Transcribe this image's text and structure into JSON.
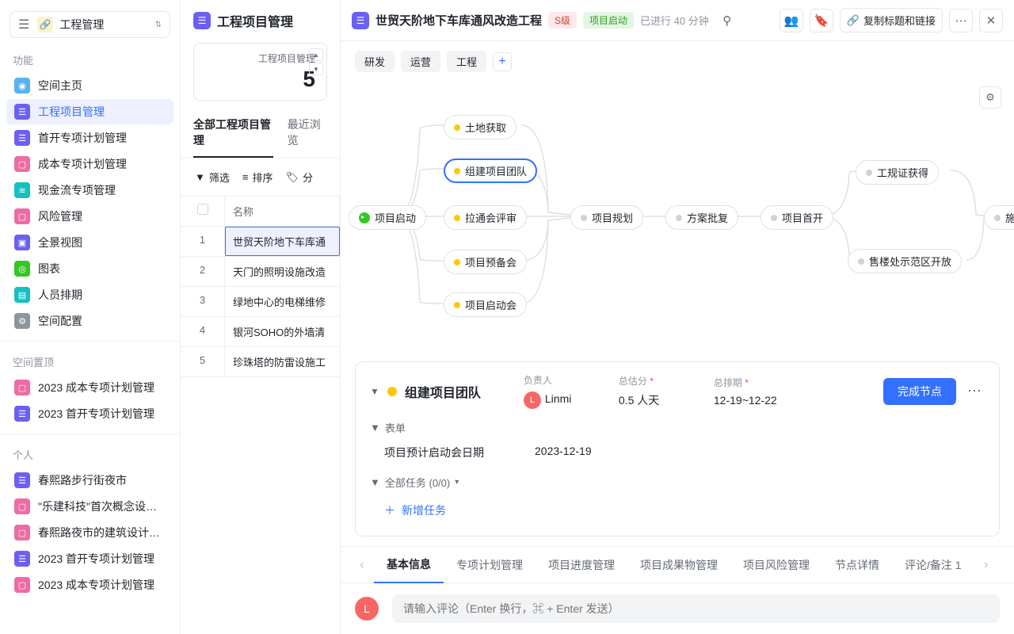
{
  "workspace": {
    "name": "工程管理"
  },
  "sidebar": {
    "sec_func": "功能",
    "func": [
      {
        "label": "空间主页",
        "color": "#5bb1f2",
        "icon": "◉"
      },
      {
        "label": "工程项目管理",
        "color": "#6b5ff5",
        "icon": "☰",
        "active": true
      },
      {
        "label": "首开专项计划管理",
        "color": "#6b5ff5",
        "icon": "☰"
      },
      {
        "label": "成本专项计划管理",
        "color": "#ee6ba5",
        "icon": "▢"
      },
      {
        "label": "现金流专项管理",
        "color": "#14c0c0",
        "icon": "≋"
      },
      {
        "label": "风险管理",
        "color": "#ee6ba5",
        "icon": "▢"
      },
      {
        "label": "全景视图",
        "color": "#6b5ff5",
        "icon": "▣"
      },
      {
        "label": "图表",
        "color": "#34c724",
        "icon": "◎"
      },
      {
        "label": "人员排期",
        "color": "#14c0c0",
        "icon": "▤"
      },
      {
        "label": "空间配置",
        "color": "#8f959e",
        "icon": "⚙"
      }
    ],
    "sec_pin": "空间置顶",
    "pin": [
      {
        "label": "2023 成本专项计划管理",
        "color": "#ee6ba5",
        "icon": "▢"
      },
      {
        "label": "2023 首开专项计划管理",
        "color": "#6b5ff5",
        "icon": "☰"
      }
    ],
    "sec_personal": "个人",
    "personal": [
      {
        "label": "春熙路步行街夜市",
        "color": "#6b5ff5",
        "icon": "☰"
      },
      {
        "label": "\"乐建科技\"首次概念设计计...",
        "color": "#ee6ba5",
        "icon": "▢"
      },
      {
        "label": "春熙路夜市的建筑设计风险",
        "color": "#ee6ba5",
        "icon": "▢"
      },
      {
        "label": "2023 首开专项计划管理",
        "color": "#6b5ff5",
        "icon": "☰"
      },
      {
        "label": "2023 成本专项计划管理",
        "color": "#ee6ba5",
        "icon": "▢"
      }
    ]
  },
  "mid": {
    "title": "工程项目管理",
    "stat_lbl": "工程项目管理",
    "stat_val": "5",
    "tabs": [
      "全部工程项目管理",
      "最近浏览"
    ],
    "tool_filter": "筛选",
    "tool_sort": "排序",
    "tool_group": "分",
    "col_name": "名称",
    "rows": [
      "世贸天阶地下车库通",
      "天门的照明设施改造",
      "绿地中心的电梯维修",
      "银河SOHO的外墙清",
      "珍珠塔的防雷设施工"
    ]
  },
  "top": {
    "title": "世贸天阶地下车库通风改造工程",
    "level": "S级",
    "phase": "项目启动",
    "status": "已进行 40 分钟",
    "copy": "复制标题和链接"
  },
  "tags": [
    "研发",
    "运营",
    "工程"
  ],
  "flow": {
    "n1": "项目启动",
    "n2a": "土地获取",
    "n2b": "组建项目团队",
    "n2c": "拉通会评审",
    "n2d": "项目预备会",
    "n2e": "项目启动会",
    "n3": "项目规划",
    "n4": "方案批复",
    "n5": "项目首开",
    "n6a": "工规证获得",
    "n6b": "售楼处示范区开放",
    "n7": "施"
  },
  "detail": {
    "title": "组建项目团队",
    "owner_lbl": "负责人",
    "owner": "Linmi",
    "est_lbl": "总估分",
    "est": "0.5 人天",
    "date_lbl": "总排期",
    "date": "12-19~12-22",
    "complete": "完成节点",
    "form_sec": "表单",
    "form_k": "项目预计启动会日期",
    "form_v": "2023-12-19",
    "tasks_sec": "全部任务 (0/0)",
    "add_task": "新增任务"
  },
  "bot_tabs": [
    "基本信息",
    "专项计划管理",
    "项目进度管理",
    "项目成果物管理",
    "项目风险管理",
    "节点详情",
    "评论/备注  1"
  ],
  "comment_ph": "请输入评论（Enter 换行，⌘ + Enter 发送）"
}
